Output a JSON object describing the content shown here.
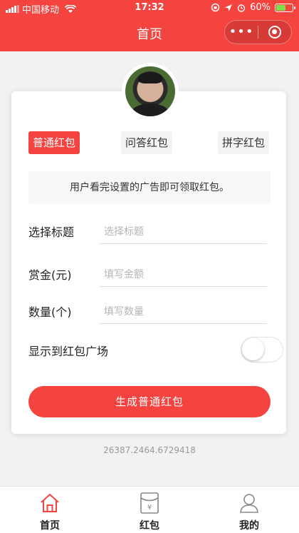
{
  "status_bar": {
    "carrier": "中国移动",
    "time": "17:32",
    "battery": "60%",
    "battery_level": 0.6
  },
  "nav": {
    "title": "首页",
    "more_icon": "more-dots-icon",
    "capsule_icon": "target-icon"
  },
  "tabs": [
    {
      "label": "普通红包",
      "active": true
    },
    {
      "label": "问答红包",
      "active": false
    },
    {
      "label": "拼字红包",
      "active": false
    }
  ],
  "notice": "用户看完设置的广告即可领取红包。",
  "form": {
    "title": {
      "label": "选择标题",
      "placeholder": "选择标题"
    },
    "amount": {
      "label": "赏金(元)",
      "placeholder": "填写金额"
    },
    "quantity": {
      "label": "数量(个)",
      "placeholder": "填写数量"
    },
    "public": {
      "label": "显示到红包广场",
      "enabled": false
    }
  },
  "generate_button": "生成普通红包",
  "coordinates": "26387.2464.6729418",
  "tabbar": [
    {
      "label": "首页",
      "icon": "home-icon",
      "active": true
    },
    {
      "label": "红包",
      "icon": "red-packet-icon",
      "active": false
    },
    {
      "label": "我的",
      "icon": "user-icon",
      "active": false
    }
  ],
  "colors": {
    "accent": "#f5433f",
    "battery": "#7fe04a"
  }
}
